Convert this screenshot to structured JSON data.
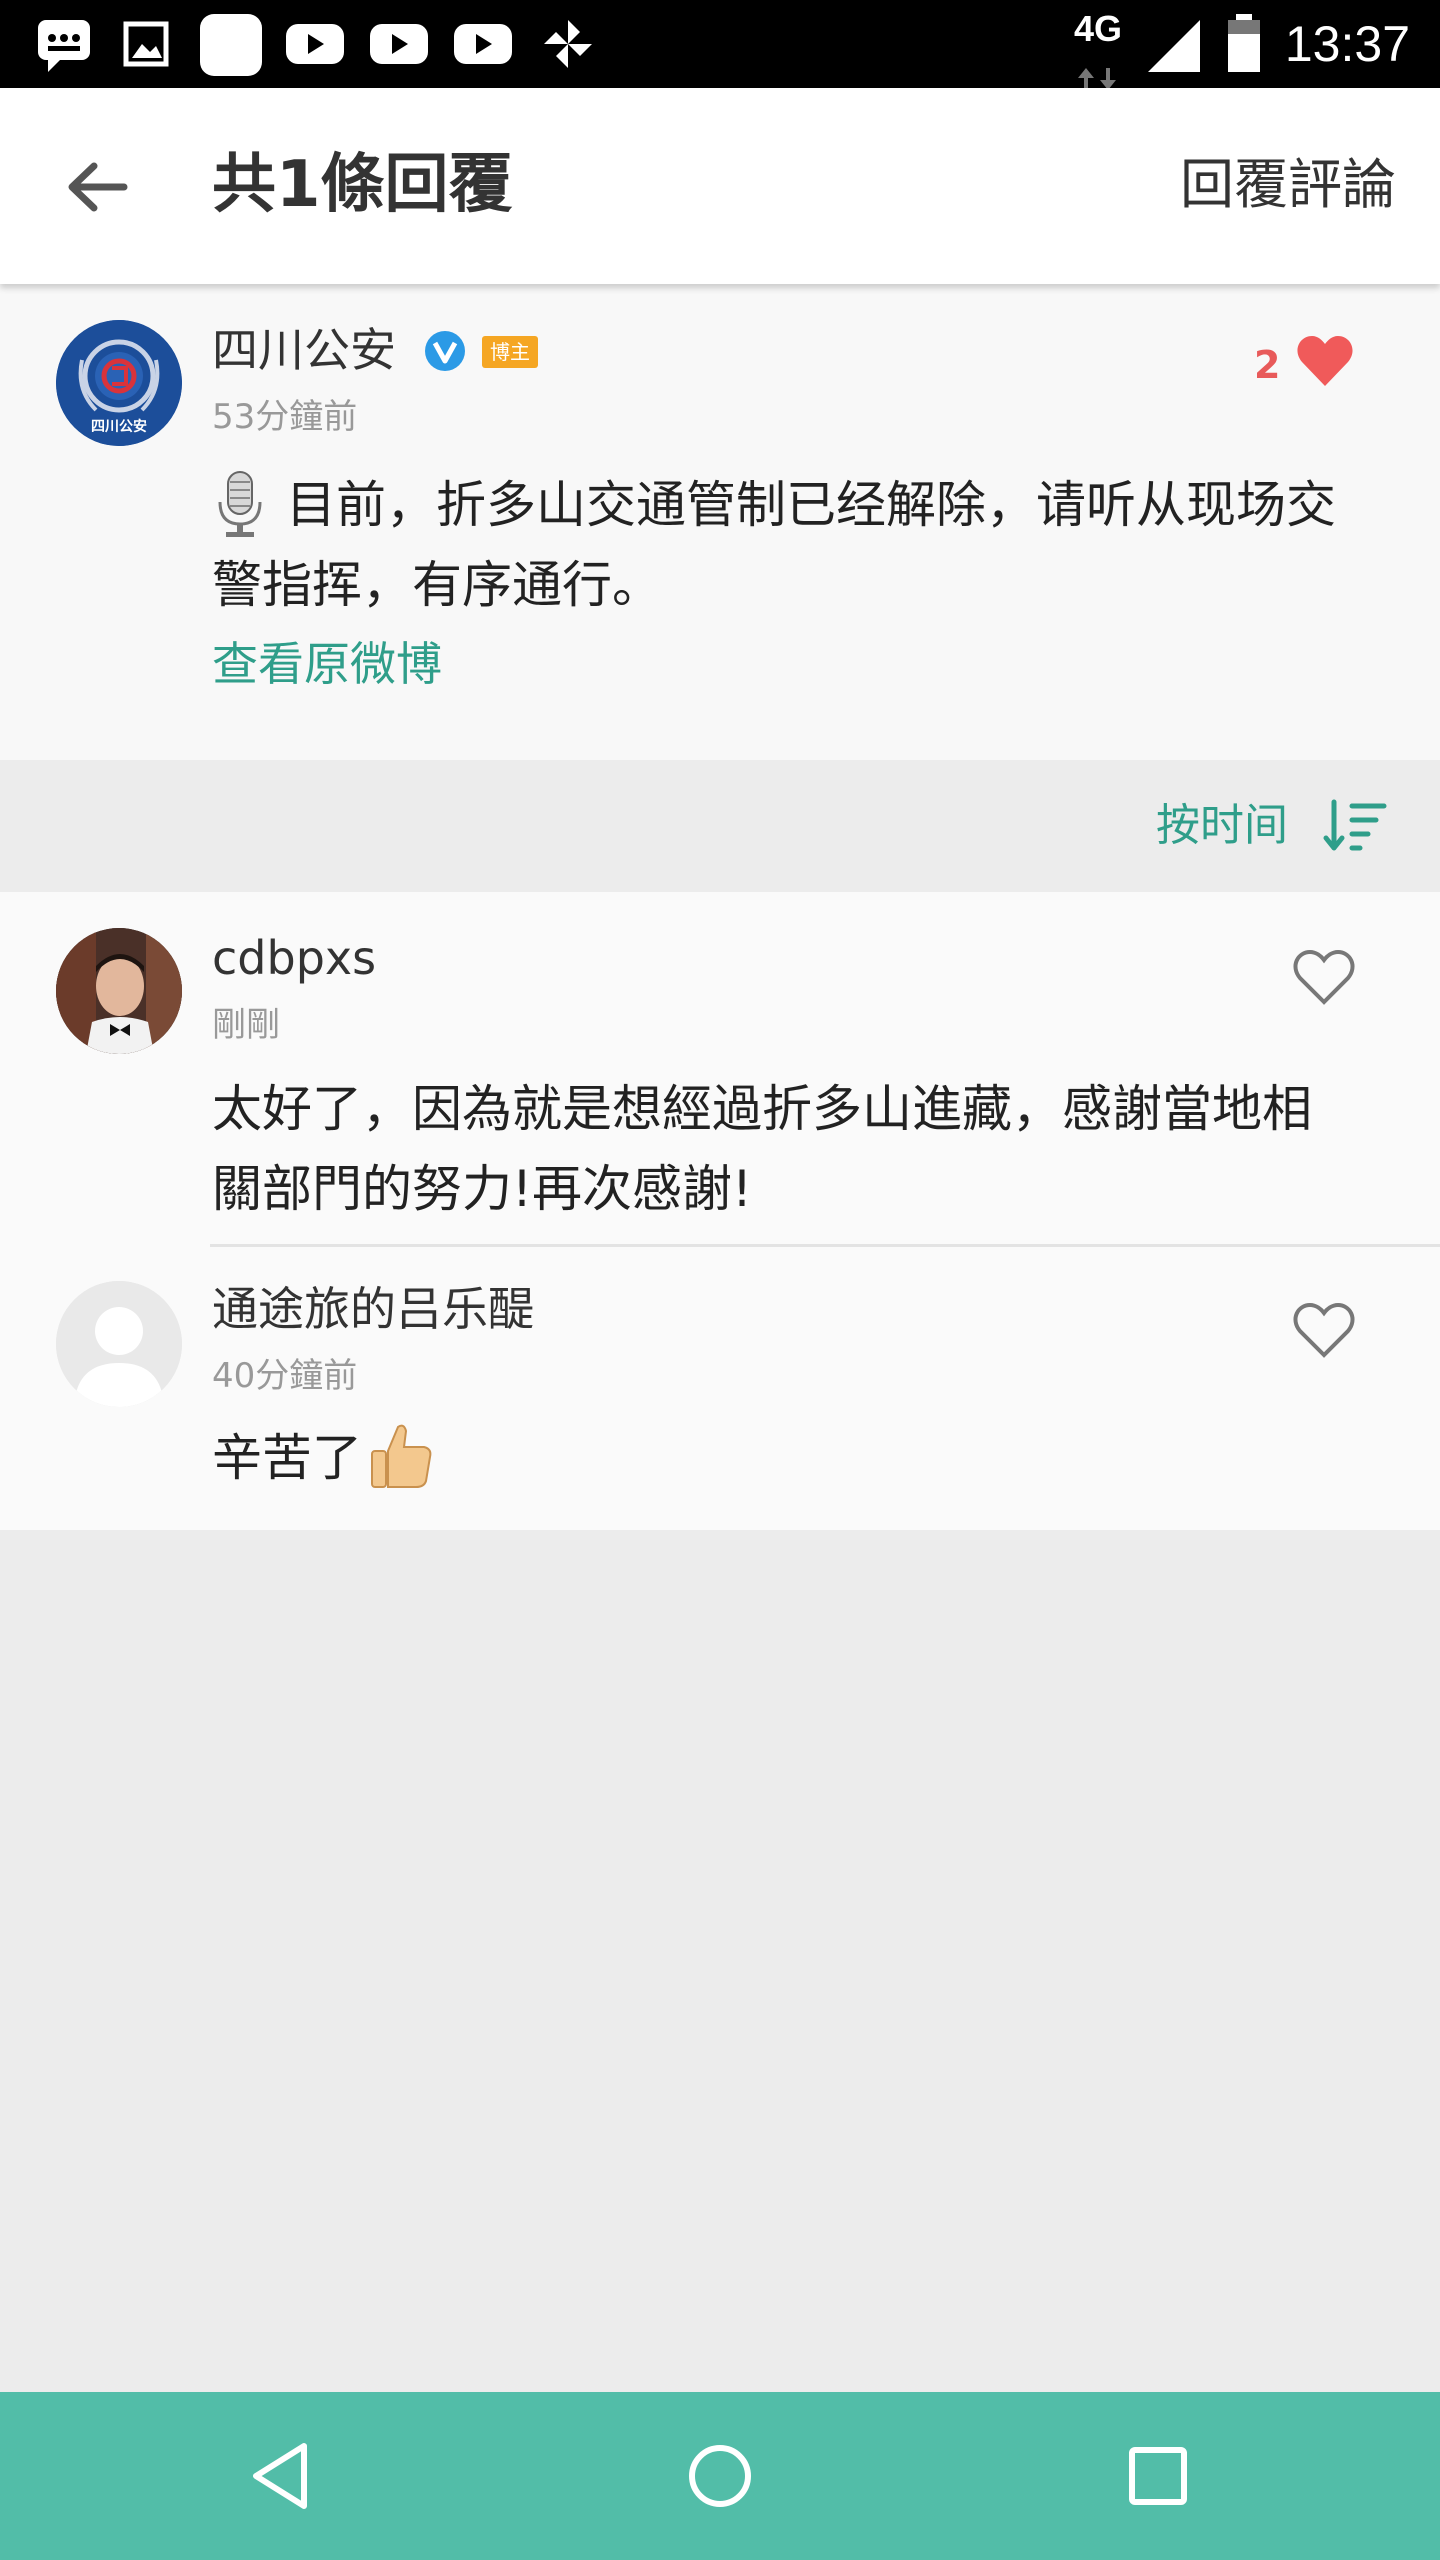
{
  "status_bar": {
    "network": "4G",
    "time": "13:37"
  },
  "app_bar": {
    "title": "共1條回覆",
    "reply_label": "回覆評論"
  },
  "original_post": {
    "author": "四川公安",
    "badge": "博主",
    "avatar_text": "四川公安",
    "time": "53分鐘前",
    "like_count": "2",
    "text_line1": "目前，折多山交通管制已经解除，请听从现场交",
    "text_line2": "警指挥，有序通行。",
    "view_original_label": "查看原微博"
  },
  "sort": {
    "label": "按时间"
  },
  "comments": [
    {
      "author": "cdbpxs",
      "time": "剛剛",
      "text_line1": "太好了，因為就是想經過折多山進藏，感謝當地相",
      "text_line2": "關部門的努力!再次感謝!"
    },
    {
      "author": "通途旅的吕乐醍",
      "time": "40分鐘前",
      "text": "辛苦了"
    }
  ],
  "colors": {
    "accent": "#2f9e8a",
    "navbar": "#52bda8",
    "like_red": "#e85a5a",
    "verified_blue": "#2b9ae6",
    "badge_orange": "#f5a623"
  },
  "icons": [
    "back-arrow-icon",
    "verified-icon",
    "heart-filled-icon",
    "sort-icon",
    "heart-outline-icon",
    "microphone-emoji-icon",
    "thumbs-up-emoji-icon",
    "nav-back-icon",
    "nav-home-icon",
    "nav-recents-icon"
  ]
}
